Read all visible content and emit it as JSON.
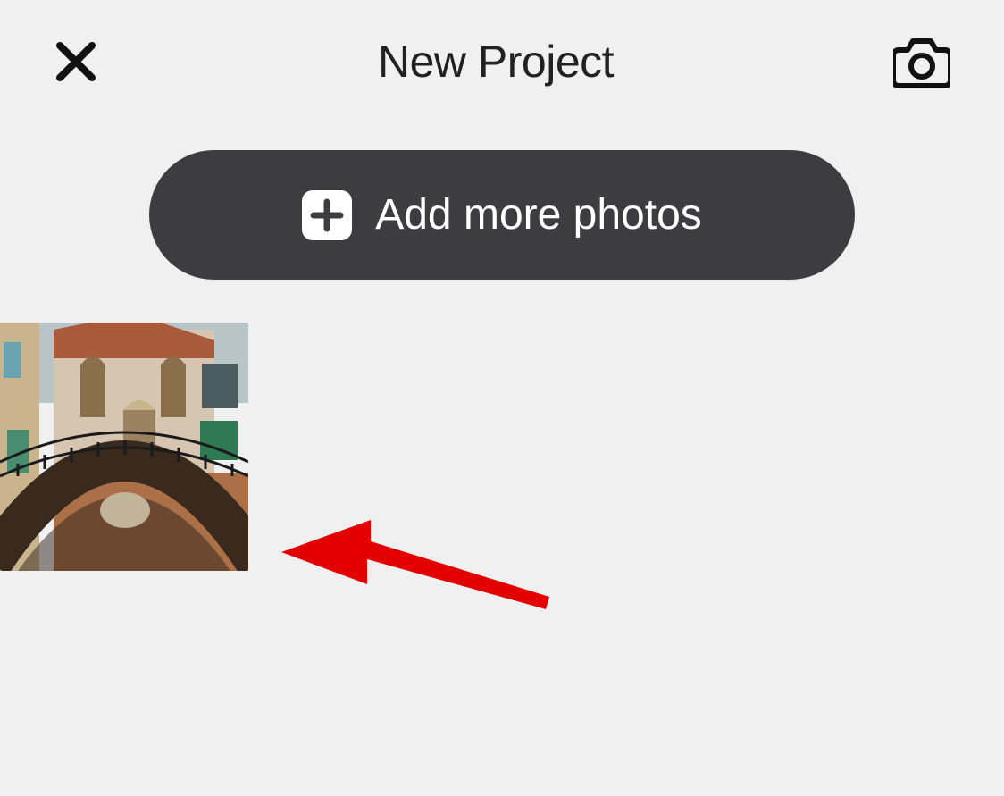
{
  "header": {
    "title": "New Project"
  },
  "buttons": {
    "add_more_label": "Add more photos"
  },
  "thumbnails": [
    {
      "alt": "venice-canal-painting"
    }
  ]
}
